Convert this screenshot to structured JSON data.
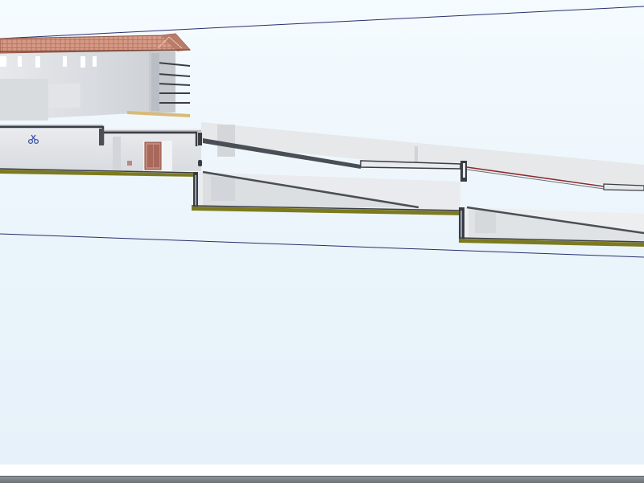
{
  "view": {
    "kind": "3D section view",
    "background_color": "#eef6fc",
    "section_outline_color": "#2a2f6b",
    "slab_color": "#7c7a1e",
    "concrete_color": "#e2e4e6",
    "roof_color": "#c98873",
    "door_color": "#b9786a",
    "rail_color": "#8e2a2a"
  },
  "icons": {
    "marker": "scissors-marker-icon"
  },
  "status_bar": {
    "text": ""
  }
}
